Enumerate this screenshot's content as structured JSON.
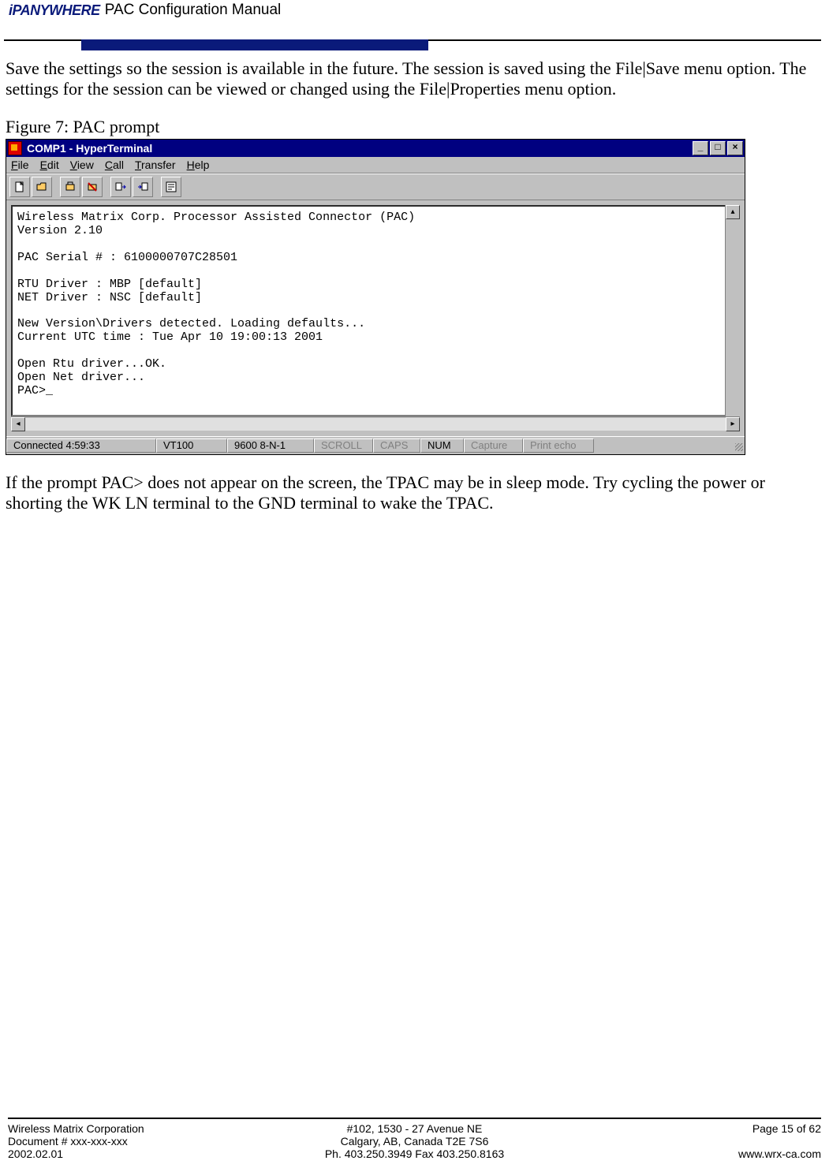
{
  "header": {
    "logo_text": "iPANYWHERE",
    "manual_title": "PAC Configuration Manual"
  },
  "body": {
    "para1": "Save the settings so the session is available in the future.  The session is saved using the File|Save menu option.  The settings for the session can be viewed or changed using the File|Properties menu option.",
    "figure_caption": "Figure 7: PAC prompt",
    "para2": "If the prompt PAC> does not appear on the screen, the TPAC may be in sleep mode. Try cycling the power or shorting the WK LN terminal to the GND terminal to wake the TPAC."
  },
  "hyperterminal": {
    "title": "COMP1 - HyperTerminal",
    "menu": {
      "file": "File",
      "edit": "Edit",
      "view": "View",
      "call": "Call",
      "transfer": "Transfer",
      "help": "Help"
    },
    "terminal_text": "Wireless Matrix Corp. Processor Assisted Connector (PAC)\nVersion 2.10\n\nPAC Serial # : 6100000707C28501\n\nRTU Driver : MBP [default]\nNET Driver : NSC [default]\n\nNew Version\\Drivers detected. Loading defaults...\nCurrent UTC time : Tue Apr 10 19:00:13 2001\n\nOpen Rtu driver...OK.\nOpen Net driver...\nPAC>_",
    "status": {
      "connected": "Connected 4:59:33",
      "emulation": "VT100",
      "settings": "9600 8-N-1",
      "scroll": "SCROLL",
      "caps": "CAPS",
      "num": "NUM",
      "capture": "Capture",
      "print_echo": "Print echo"
    }
  },
  "footer": {
    "left1": "Wireless Matrix Corporation",
    "left2": "Document # xxx-xxx-xxx",
    "left3": "2002.02.01",
    "center1": "#102, 1530 - 27 Avenue NE",
    "center2": "Calgary, AB, Canada  T2E 7S6",
    "center3": "Ph. 403.250.3949  Fax 403.250.8163",
    "right1": "Page 15 of 62",
    "right3": "www.wrx-ca.com"
  }
}
